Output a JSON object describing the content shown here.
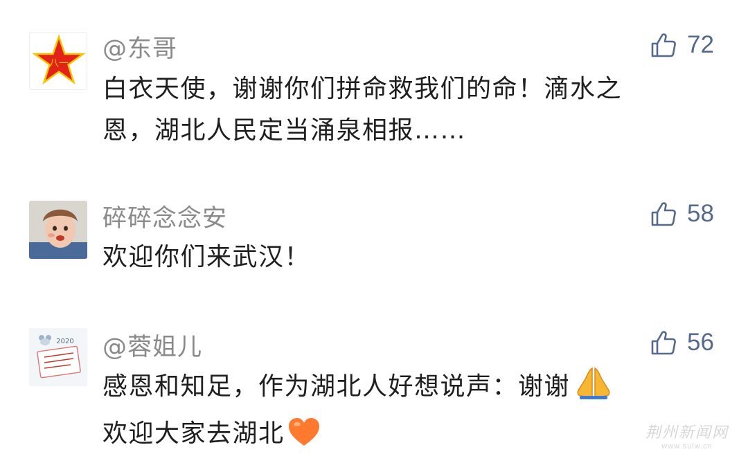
{
  "comments": [
    {
      "username": "@东哥",
      "likes": "72",
      "avatar_icon": "red-star-badge",
      "avatar_text": "八一",
      "lines": [
        "白衣天使，谢谢你们拼命救我们的命！滴水之",
        "恩，湖北人民定当涌泉相报……"
      ]
    },
    {
      "username": "碎碎念念安",
      "likes": "58",
      "avatar_icon": "child-photo",
      "lines": [
        "欢迎你们来武汉！"
      ]
    },
    {
      "username": "@蓉姐儿",
      "likes": "56",
      "avatar_icon": "mouse-calendar-card",
      "avatar_text": "2020",
      "lines": [
        "感恩和知足，作为湖北人好想说声：谢谢",
        "欢迎大家去湖北"
      ],
      "emojis": [
        "folded-hands-emoji",
        "orange-heart-emoji"
      ]
    }
  ],
  "watermark": {
    "text": "荆州新闻网",
    "url": "www.sulw.cn"
  },
  "colors": {
    "username": "#8a8a8a",
    "like": "#546a8c",
    "text": "#1f1f1f"
  }
}
